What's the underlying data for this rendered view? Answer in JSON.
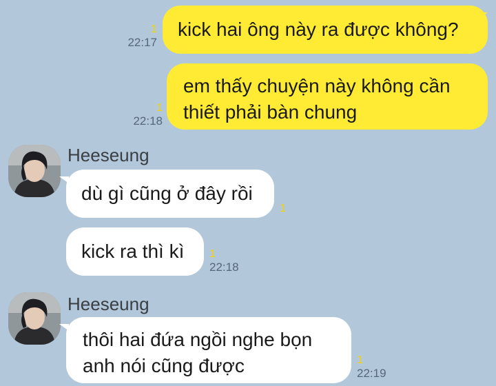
{
  "colors": {
    "background": "#b2c7da",
    "outgoing_bubble": "#ffeb33",
    "incoming_bubble": "#ffffff",
    "unread_indicator": "#f2d400",
    "timestamp": "#556677"
  },
  "messages": [
    {
      "direction": "outgoing",
      "lines": [
        "kick hai ông này ra được không?"
      ],
      "unread": "1",
      "time": "22:17"
    },
    {
      "direction": "outgoing",
      "lines": [
        "em thấy chuyện này không cần",
        "thiết phải bàn chung"
      ],
      "unread": "1",
      "time": "22:18"
    },
    {
      "direction": "incoming",
      "sender": "Heeseung",
      "avatar_icon": "profile-photo",
      "lines": [
        "dù gì cũng ở đây rồi"
      ],
      "unread": "1",
      "time": ""
    },
    {
      "direction": "incoming",
      "lines": [
        "kick ra thì kì"
      ],
      "unread": "1",
      "time": "22:18"
    },
    {
      "direction": "incoming",
      "sender": "Heeseung",
      "avatar_icon": "profile-photo",
      "lines": [
        "thôi hai đứa ngồi nghe bọn",
        "anh nói cũng được"
      ],
      "unread": "1",
      "time": "22:19"
    }
  ]
}
